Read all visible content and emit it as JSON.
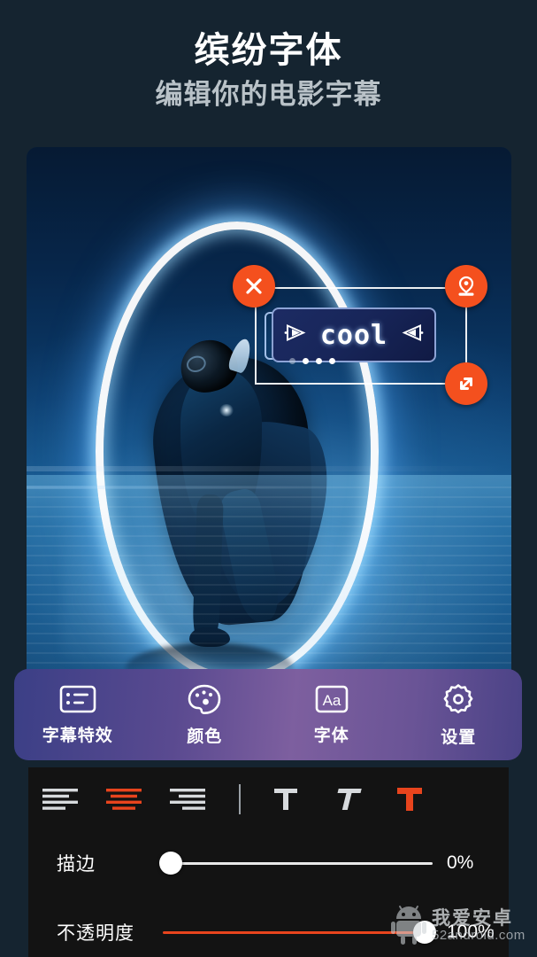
{
  "header": {
    "title": "缤纷字体",
    "subtitle": "编辑你的电影字幕"
  },
  "preview": {
    "name": "video-preview",
    "text_overlay": {
      "value": "cool",
      "dots_count": 4,
      "handles": [
        {
          "name": "close-handle",
          "icon": "close-icon"
        },
        {
          "name": "stamp-handle",
          "icon": "stamp-icon"
        },
        {
          "name": "resize-handle",
          "icon": "resize-diagonal-icon"
        }
      ],
      "accent_color": "#f4501e"
    }
  },
  "tabbar": {
    "accent_color": "#7d5f9f",
    "tabs": [
      {
        "label": "字幕特效",
        "icon": "subtitle-effects-icon",
        "name": "tab-subtitle-effects"
      },
      {
        "label": "颜色",
        "icon": "palette-icon",
        "name": "tab-color"
      },
      {
        "label": "字体",
        "icon": "font-aa-icon",
        "name": "tab-font"
      },
      {
        "label": "设置",
        "icon": "gear-icon",
        "name": "tab-settings"
      }
    ]
  },
  "options": {
    "alignment": [
      {
        "name": "align-left-button",
        "icon": "align-left-icon",
        "selected": false
      },
      {
        "name": "align-center-button",
        "icon": "align-center-icon",
        "selected": true
      },
      {
        "name": "align-right-button",
        "icon": "align-right-icon",
        "selected": false
      }
    ],
    "text_styles": [
      {
        "name": "style-regular-button",
        "icon": "text-regular-icon",
        "selected": false
      },
      {
        "name": "style-italic-button",
        "icon": "text-italic-icon",
        "selected": false
      },
      {
        "name": "style-bold-button",
        "icon": "text-bold-icon",
        "selected": true
      }
    ],
    "selected_color": "#e8441d",
    "sliders": [
      {
        "name": "stroke-slider",
        "label": "描边",
        "value": "0%",
        "fill": 0
      },
      {
        "name": "opacity-slider",
        "label": "不透明度",
        "value": "100%",
        "fill": 100
      }
    ]
  },
  "watermark": {
    "cn": "我爱安卓",
    "en": "52android.com",
    "icon": "android-robot-icon"
  }
}
